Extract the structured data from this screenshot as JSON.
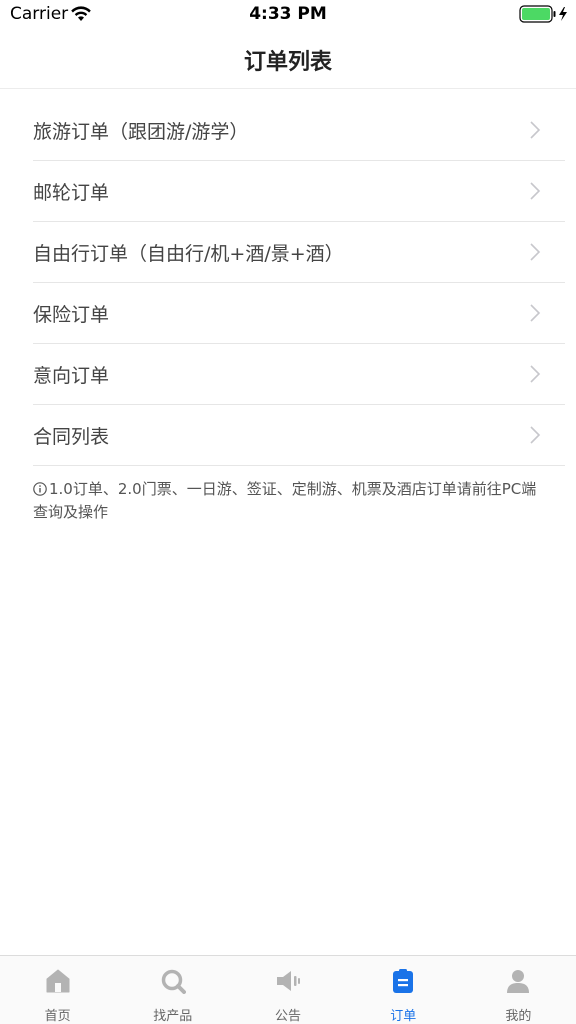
{
  "status_bar": {
    "carrier": "Carrier",
    "time": "4:33 PM"
  },
  "nav": {
    "title": "订单列表"
  },
  "orders": [
    {
      "label": "旅游订单（跟团游/游学）"
    },
    {
      "label": "邮轮订单"
    },
    {
      "label": "自由行订单（自由行/机+酒/景+酒）"
    },
    {
      "label": "保险订单"
    },
    {
      "label": "意向订单"
    },
    {
      "label": "合同列表"
    }
  ],
  "notice": {
    "text": "1.0订单、2.0门票、一日游、签证、定制游、机票及酒店订单请前往PC端查询及操作"
  },
  "tabs": [
    {
      "label": "首页",
      "icon": "home-icon",
      "active": false
    },
    {
      "label": "找产品",
      "icon": "search-icon",
      "active": false
    },
    {
      "label": "公告",
      "icon": "megaphone-icon",
      "active": false
    },
    {
      "label": "订单",
      "icon": "clipboard-icon",
      "active": true
    },
    {
      "label": "我的",
      "icon": "user-icon",
      "active": false
    }
  ],
  "colors": {
    "accent": "#1a73e8",
    "battery": "#4cd964",
    "inactive_icon": "#b3b3b3"
  }
}
